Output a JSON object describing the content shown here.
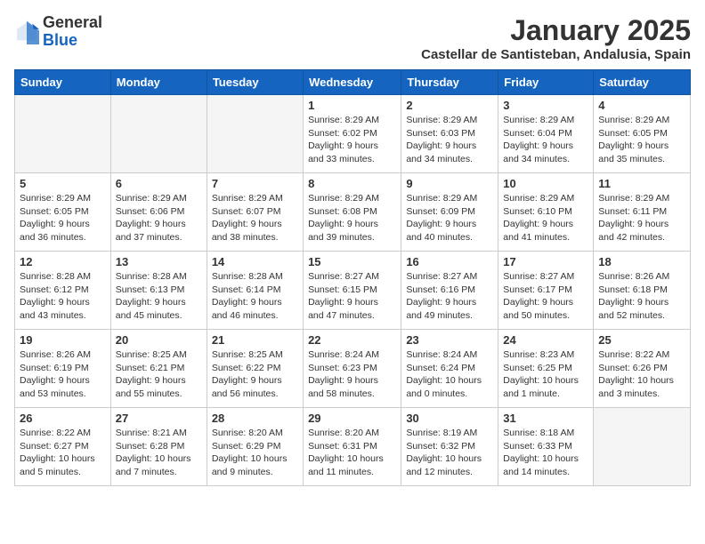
{
  "header": {
    "logo_general": "General",
    "logo_blue": "Blue",
    "month_title": "January 2025",
    "subtitle": "Castellar de Santisteban, Andalusia, Spain"
  },
  "weekdays": [
    "Sunday",
    "Monday",
    "Tuesday",
    "Wednesday",
    "Thursday",
    "Friday",
    "Saturday"
  ],
  "weeks": [
    [
      {
        "day": "",
        "info": ""
      },
      {
        "day": "",
        "info": ""
      },
      {
        "day": "",
        "info": ""
      },
      {
        "day": "1",
        "info": "Sunrise: 8:29 AM\nSunset: 6:02 PM\nDaylight: 9 hours\nand 33 minutes."
      },
      {
        "day": "2",
        "info": "Sunrise: 8:29 AM\nSunset: 6:03 PM\nDaylight: 9 hours\nand 34 minutes."
      },
      {
        "day": "3",
        "info": "Sunrise: 8:29 AM\nSunset: 6:04 PM\nDaylight: 9 hours\nand 34 minutes."
      },
      {
        "day": "4",
        "info": "Sunrise: 8:29 AM\nSunset: 6:05 PM\nDaylight: 9 hours\nand 35 minutes."
      }
    ],
    [
      {
        "day": "5",
        "info": "Sunrise: 8:29 AM\nSunset: 6:05 PM\nDaylight: 9 hours\nand 36 minutes."
      },
      {
        "day": "6",
        "info": "Sunrise: 8:29 AM\nSunset: 6:06 PM\nDaylight: 9 hours\nand 37 minutes."
      },
      {
        "day": "7",
        "info": "Sunrise: 8:29 AM\nSunset: 6:07 PM\nDaylight: 9 hours\nand 38 minutes."
      },
      {
        "day": "8",
        "info": "Sunrise: 8:29 AM\nSunset: 6:08 PM\nDaylight: 9 hours\nand 39 minutes."
      },
      {
        "day": "9",
        "info": "Sunrise: 8:29 AM\nSunset: 6:09 PM\nDaylight: 9 hours\nand 40 minutes."
      },
      {
        "day": "10",
        "info": "Sunrise: 8:29 AM\nSunset: 6:10 PM\nDaylight: 9 hours\nand 41 minutes."
      },
      {
        "day": "11",
        "info": "Sunrise: 8:29 AM\nSunset: 6:11 PM\nDaylight: 9 hours\nand 42 minutes."
      }
    ],
    [
      {
        "day": "12",
        "info": "Sunrise: 8:28 AM\nSunset: 6:12 PM\nDaylight: 9 hours\nand 43 minutes."
      },
      {
        "day": "13",
        "info": "Sunrise: 8:28 AM\nSunset: 6:13 PM\nDaylight: 9 hours\nand 45 minutes."
      },
      {
        "day": "14",
        "info": "Sunrise: 8:28 AM\nSunset: 6:14 PM\nDaylight: 9 hours\nand 46 minutes."
      },
      {
        "day": "15",
        "info": "Sunrise: 8:27 AM\nSunset: 6:15 PM\nDaylight: 9 hours\nand 47 minutes."
      },
      {
        "day": "16",
        "info": "Sunrise: 8:27 AM\nSunset: 6:16 PM\nDaylight: 9 hours\nand 49 minutes."
      },
      {
        "day": "17",
        "info": "Sunrise: 8:27 AM\nSunset: 6:17 PM\nDaylight: 9 hours\nand 50 minutes."
      },
      {
        "day": "18",
        "info": "Sunrise: 8:26 AM\nSunset: 6:18 PM\nDaylight: 9 hours\nand 52 minutes."
      }
    ],
    [
      {
        "day": "19",
        "info": "Sunrise: 8:26 AM\nSunset: 6:19 PM\nDaylight: 9 hours\nand 53 minutes."
      },
      {
        "day": "20",
        "info": "Sunrise: 8:25 AM\nSunset: 6:21 PM\nDaylight: 9 hours\nand 55 minutes."
      },
      {
        "day": "21",
        "info": "Sunrise: 8:25 AM\nSunset: 6:22 PM\nDaylight: 9 hours\nand 56 minutes."
      },
      {
        "day": "22",
        "info": "Sunrise: 8:24 AM\nSunset: 6:23 PM\nDaylight: 9 hours\nand 58 minutes."
      },
      {
        "day": "23",
        "info": "Sunrise: 8:24 AM\nSunset: 6:24 PM\nDaylight: 10 hours\nand 0 minutes."
      },
      {
        "day": "24",
        "info": "Sunrise: 8:23 AM\nSunset: 6:25 PM\nDaylight: 10 hours\nand 1 minute."
      },
      {
        "day": "25",
        "info": "Sunrise: 8:22 AM\nSunset: 6:26 PM\nDaylight: 10 hours\nand 3 minutes."
      }
    ],
    [
      {
        "day": "26",
        "info": "Sunrise: 8:22 AM\nSunset: 6:27 PM\nDaylight: 10 hours\nand 5 minutes."
      },
      {
        "day": "27",
        "info": "Sunrise: 8:21 AM\nSunset: 6:28 PM\nDaylight: 10 hours\nand 7 minutes."
      },
      {
        "day": "28",
        "info": "Sunrise: 8:20 AM\nSunset: 6:29 PM\nDaylight: 10 hours\nand 9 minutes."
      },
      {
        "day": "29",
        "info": "Sunrise: 8:20 AM\nSunset: 6:31 PM\nDaylight: 10 hours\nand 11 minutes."
      },
      {
        "day": "30",
        "info": "Sunrise: 8:19 AM\nSunset: 6:32 PM\nDaylight: 10 hours\nand 12 minutes."
      },
      {
        "day": "31",
        "info": "Sunrise: 8:18 AM\nSunset: 6:33 PM\nDaylight: 10 hours\nand 14 minutes."
      },
      {
        "day": "",
        "info": ""
      }
    ]
  ]
}
